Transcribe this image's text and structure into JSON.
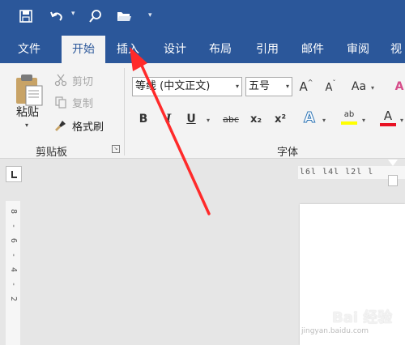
{
  "quick_access": {
    "icons": [
      "save-icon",
      "undo-icon",
      "search-icon",
      "open-folder-icon",
      "customize-icon"
    ]
  },
  "tabs": [
    {
      "label": "文件"
    },
    {
      "label": "开始",
      "active": true
    },
    {
      "label": "插入"
    },
    {
      "label": "设计"
    },
    {
      "label": "布局"
    },
    {
      "label": "引用"
    },
    {
      "label": "邮件"
    },
    {
      "label": "审阅"
    },
    {
      "label": "视"
    }
  ],
  "clipboard": {
    "paste_label": "粘贴",
    "cut_label": "剪切",
    "copy_label": "复制",
    "format_painter_label": "格式刷",
    "group_label": "剪贴板"
  },
  "font": {
    "font_name": "等线 (中文正文)",
    "font_size": "五号",
    "group_label": "字体",
    "bold": "B",
    "italic": "I",
    "underline": "U",
    "strikethrough": "abc",
    "subscript": "x₂",
    "superscript": "x²",
    "text_effects": "A",
    "highlight": "ab",
    "font_color": "A",
    "change_case": "Aa",
    "grow_font": "A",
    "shrink_font": "A"
  },
  "ruler": {
    "horizontal_text": "l6l  l4l  l2l  l",
    "vertical_marks": [
      "8",
      "6",
      "4",
      "2"
    ]
  },
  "watermark": {
    "text": "Bai 经验",
    "sub": "jingyan.baidu.com"
  },
  "colors": {
    "brand_blue": "#2b579a",
    "highlight_yellow": "#ffff00",
    "font_red": "#e81123",
    "annotation_arrow": "#ff2a2a"
  }
}
